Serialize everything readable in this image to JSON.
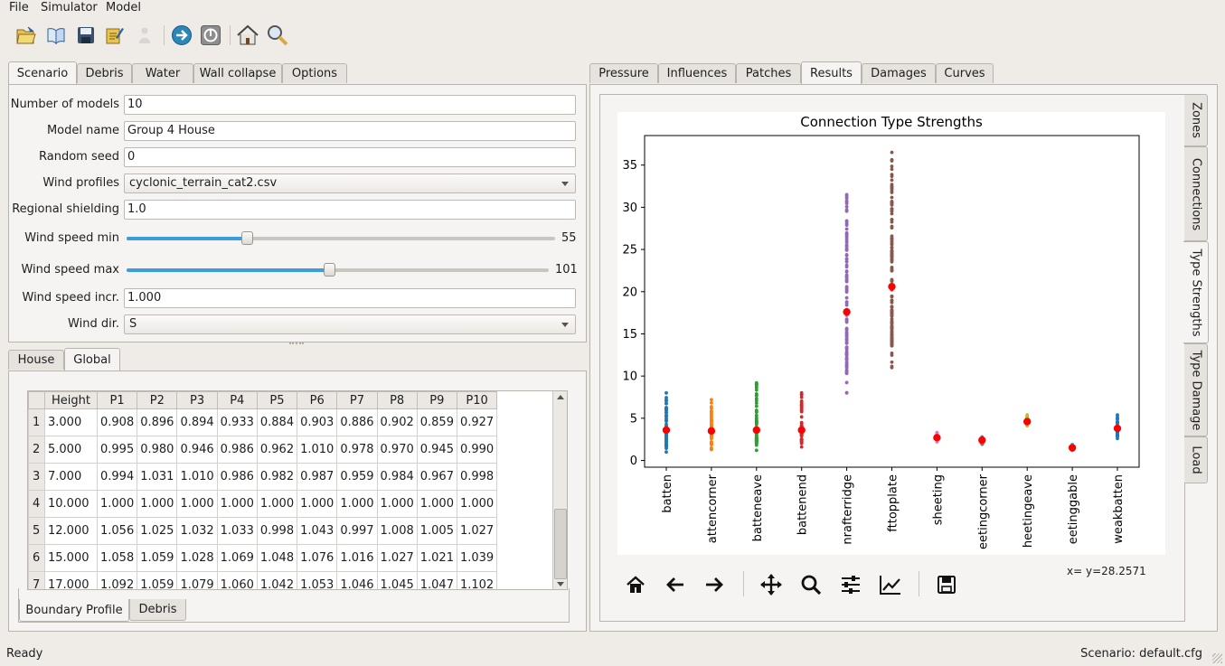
{
  "menu": [
    "File",
    "Simulator",
    "Model"
  ],
  "toolbar": {
    "icons": [
      "open-folder-icon",
      "open-book-icon",
      "save-icon",
      "edit-icon",
      "person-icon",
      "run-icon",
      "stop-icon",
      "home-icon",
      "zoom-icon"
    ]
  },
  "left_tabs": [
    "Scenario",
    "Debris",
    "Water",
    "Wall collapse",
    "Options"
  ],
  "scenario": {
    "num_models_label": "Number of models",
    "num_models": "10",
    "model_name_label": "Model name",
    "model_name": "Group 4 House",
    "seed_label": "Random seed",
    "seed": "0",
    "profiles_label": "Wind profiles",
    "profiles": "cyclonic_terrain_cat2.csv",
    "shield_label": "Regional shielding",
    "shield": "1.0",
    "ws_min_label": "Wind speed min",
    "ws_min": "55",
    "ws_min_frac": 0.28,
    "ws_max_label": "Wind speed max",
    "ws_max": "101",
    "ws_max_frac": 0.48,
    "ws_incr_label": "Wind speed incr.",
    "ws_incr": "1.000",
    "wind_dir_label": "Wind dir.",
    "wind_dir": "S"
  },
  "bottom_tabs": [
    "House",
    "Global"
  ],
  "table": {
    "headers": [
      "Height",
      "P1",
      "P2",
      "P3",
      "P4",
      "P5",
      "P6",
      "P7",
      "P8",
      "P9",
      "P10"
    ],
    "rows": [
      [
        "1",
        "3.000",
        "0.908",
        "0.896",
        "0.894",
        "0.933",
        "0.884",
        "0.903",
        "0.886",
        "0.902",
        "0.859",
        "0.927"
      ],
      [
        "2",
        "5.000",
        "0.995",
        "0.980",
        "0.946",
        "0.986",
        "0.962",
        "1.010",
        "0.978",
        "0.970",
        "0.945",
        "0.990"
      ],
      [
        "3",
        "7.000",
        "0.994",
        "1.031",
        "1.010",
        "0.986",
        "0.982",
        "0.987",
        "0.959",
        "0.984",
        "0.967",
        "0.998"
      ],
      [
        "4",
        "10.000",
        "1.000",
        "1.000",
        "1.000",
        "1.000",
        "1.000",
        "1.000",
        "1.000",
        "1.000",
        "1.000",
        "1.000"
      ],
      [
        "5",
        "12.000",
        "1.056",
        "1.025",
        "1.032",
        "1.033",
        "0.998",
        "1.043",
        "0.997",
        "1.008",
        "1.005",
        "1.027"
      ],
      [
        "6",
        "15.000",
        "1.058",
        "1.059",
        "1.028",
        "1.069",
        "1.048",
        "1.076",
        "1.016",
        "1.027",
        "1.021",
        "1.039"
      ],
      [
        "7",
        "17.000",
        "1.092",
        "1.059",
        "1.079",
        "1.060",
        "1.042",
        "1.053",
        "1.046",
        "1.045",
        "1.047",
        "1.102"
      ]
    ]
  },
  "sub_tabs": [
    "Boundary Profile",
    "Debris"
  ],
  "right_tabs": [
    "Pressure",
    "Influences",
    "Patches",
    "Results",
    "Damages",
    "Curves"
  ],
  "side_tabs": [
    "Zones",
    "Connections",
    "Type Strengths",
    "Type Damage",
    "Load"
  ],
  "chart_data": {
    "type": "scatter",
    "title": "Connection Type Strengths",
    "categories": [
      "batten",
      "battencorner",
      "batteneave",
      "battenend",
      "rafterridge",
      "rafttopplate",
      "sheeting",
      "sheetingcorner",
      "sheetingeave",
      "sheetinggable",
      "weakbatten"
    ],
    "category_labels_shown": [
      "batten",
      "attencorner",
      "batteneave",
      "battenend",
      "nrafterridge",
      "fttopplate",
      "sheeting",
      "eetingcorner",
      "heetingeave",
      "eetinggable",
      "weakbatten"
    ],
    "ranges": [
      [
        1.0,
        8.0
      ],
      [
        1.3,
        7.2
      ],
      [
        1.2,
        9.2
      ],
      [
        1.6,
        8.0
      ],
      [
        8.0,
        31.5
      ],
      [
        11.0,
        36.5
      ],
      [
        2.2,
        3.3
      ],
      [
        1.9,
        2.8
      ],
      [
        4.1,
        5.4
      ],
      [
        1.2,
        1.9
      ],
      [
        2.6,
        5.4
      ]
    ],
    "means": [
      3.6,
      3.5,
      3.6,
      3.6,
      17.6,
      20.6,
      2.7,
      2.4,
      4.6,
      1.5,
      3.8
    ],
    "colors": [
      "#1f77b4",
      "#ff7f0e",
      "#2ca02c",
      "#d62728",
      "#9467bd",
      "#8c564b",
      "#e377c2",
      "#7f7f7f",
      "#bcbd22",
      "#17becf",
      "#1f77b4"
    ],
    "mean_color": "#ff0000",
    "ylim": [
      -0.8,
      38.5
    ],
    "yticks": [
      0,
      5,
      10,
      15,
      20,
      25,
      30,
      35
    ]
  },
  "nav_icons": [
    "home-icon",
    "back-arrow-icon",
    "forward-arrow-icon",
    "pan-icon",
    "zoom-icon",
    "configure-subplots-icon",
    "edit-axis-icon",
    "save-figure-icon"
  ],
  "coord_readout": "x= y=28.2571",
  "status": {
    "left": "Ready",
    "right": "Scenario: default.cfg"
  }
}
